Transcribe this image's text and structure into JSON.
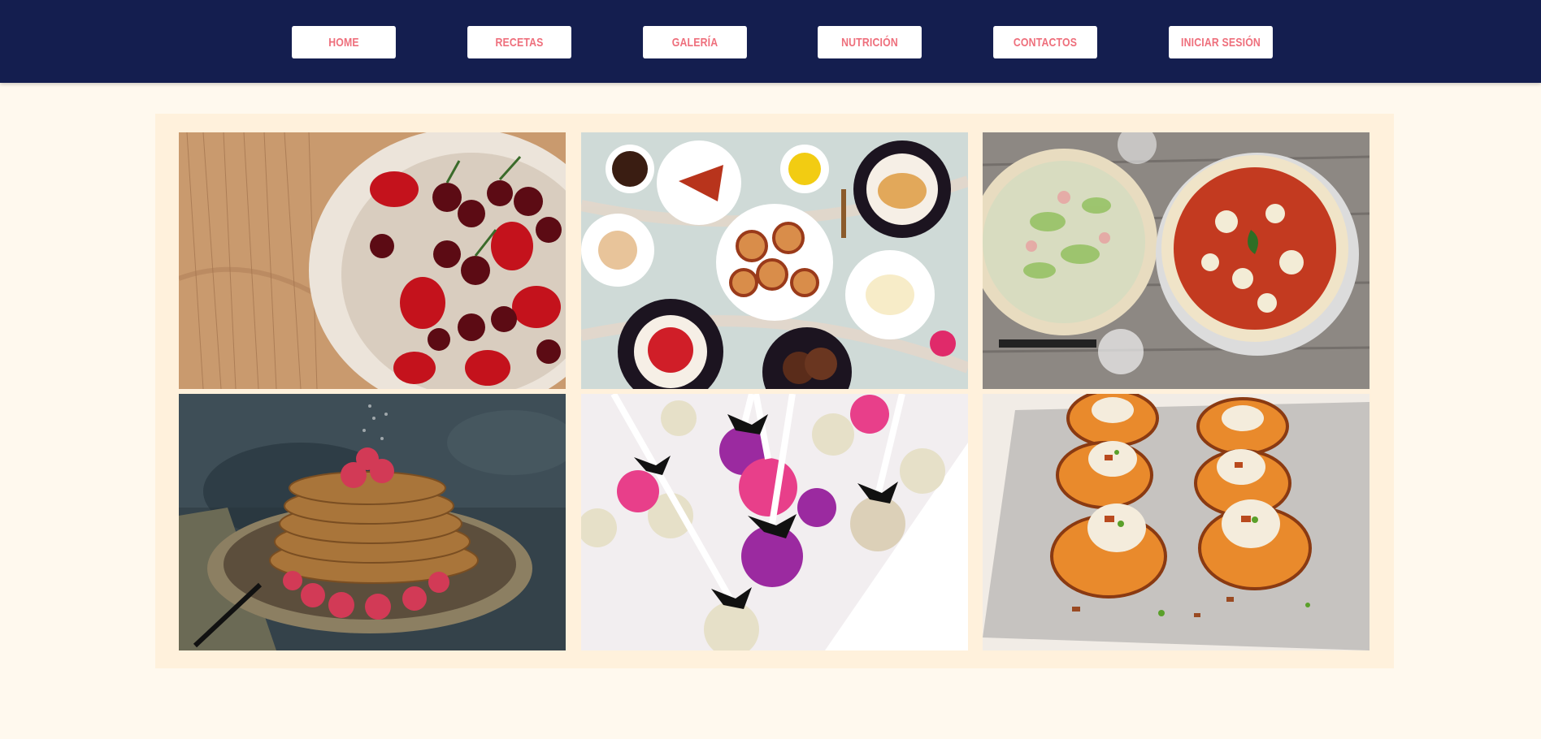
{
  "nav": {
    "items": [
      {
        "label": "HOME"
      },
      {
        "label": "RECETAS"
      },
      {
        "label": "GALERÍA"
      },
      {
        "label": "NUTRICIÓN"
      },
      {
        "label": "CONTACTOS"
      },
      {
        "label": "INICIAR SESIÓN"
      }
    ]
  },
  "colors": {
    "navbar": "#141e4f",
    "nav_text": "#ee6f7c",
    "page_bg": "#fff9ee",
    "gallery_bg": "#fff1dc"
  },
  "gallery": {
    "photos": [
      {
        "subject": "cherries-strawberries-bowl-photo"
      },
      {
        "subject": "pastries-table-photo"
      },
      {
        "subject": "pizzas-wood-table-photo"
      },
      {
        "subject": "pancakes-raspberries-photo"
      },
      {
        "subject": "cake-pops-photo"
      },
      {
        "subject": "grilled-peaches-photo"
      }
    ]
  }
}
